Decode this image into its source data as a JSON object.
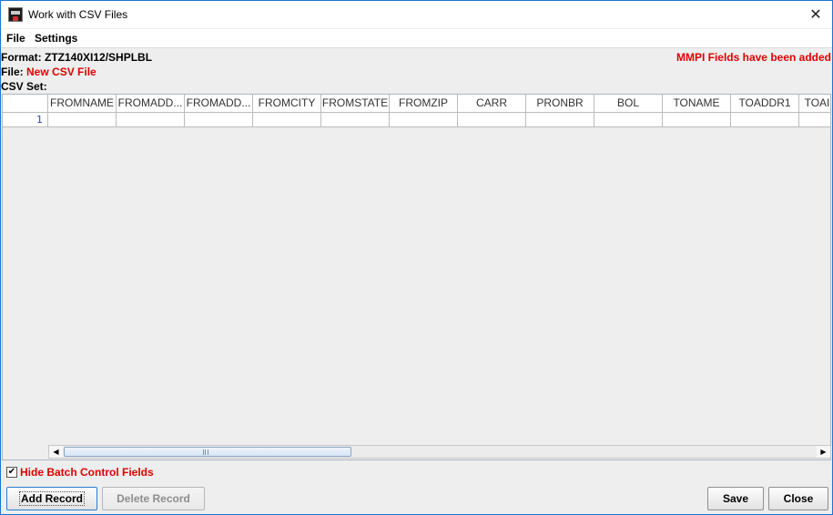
{
  "window": {
    "title": "Work with CSV Files",
    "close_glyph": "✕"
  },
  "menu": {
    "items": [
      "File",
      "Settings"
    ]
  },
  "info": {
    "format_label": "Format:",
    "format_value": "ZTZ140XI12/SHPLBL",
    "file_label": "File:",
    "file_value": "New CSV File",
    "csvset_label": "CSV Set:",
    "mmpi_notice": "MMPI Fields have been added"
  },
  "table": {
    "columns": [
      "FROMNAME",
      "FROMADD...",
      "FROMADD...",
      "FROMCITY",
      "FROMSTATE",
      "FROMZIP",
      "CARR",
      "PRONBR",
      "BOL",
      "TONAME",
      "TOADDR1",
      "TOAI"
    ],
    "rows": [
      {
        "index": "1",
        "cells": [
          "",
          "",
          "",
          "",
          "",
          "",
          "",
          "",
          "",
          "",
          "",
          ""
        ]
      }
    ]
  },
  "scrollbar": {
    "left_arrow": "◀",
    "right_arrow": "▶"
  },
  "options": {
    "hide_batch_checked": "✔",
    "hide_batch_label": "Hide Batch Control Fields"
  },
  "buttons": {
    "add_record": "Add Record",
    "delete_record": "Delete Record",
    "save": "Save",
    "close": "Close"
  },
  "colors": {
    "accent_red": "#e00000",
    "window_border": "#1c74d4",
    "row_index_blue": "#2f3fd0"
  }
}
